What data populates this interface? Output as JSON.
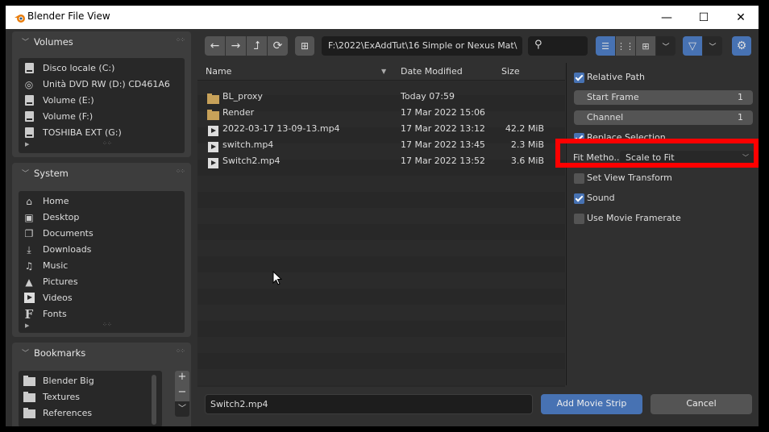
{
  "window": {
    "title": "Blender File View",
    "controls": [
      "—",
      "☐",
      "✕"
    ]
  },
  "sidebar": {
    "volumes": {
      "label": "Volumes",
      "items": [
        {
          "icon": "drive-icon",
          "label": "Disco locale (C:)"
        },
        {
          "icon": "dvd-icon",
          "label": "Unità DVD RW (D:) CD461A6"
        },
        {
          "icon": "drive-icon",
          "label": "Volume (E:)"
        },
        {
          "icon": "drive-icon",
          "label": "Volume (F:)"
        },
        {
          "icon": "drive-icon",
          "label": "TOSHIBA EXT (G:)"
        }
      ]
    },
    "system": {
      "label": "System",
      "items": [
        {
          "icon": "home-icon",
          "glyph": "⌂",
          "label": "Home"
        },
        {
          "icon": "desktop-icon",
          "glyph": "▣",
          "label": "Desktop"
        },
        {
          "icon": "documents-icon",
          "glyph": "❐",
          "label": "Documents"
        },
        {
          "icon": "download-icon",
          "glyph": "⤓",
          "label": "Downloads"
        },
        {
          "icon": "music-icon",
          "glyph": "♫",
          "label": "Music"
        },
        {
          "icon": "pictures-icon",
          "glyph": "▲",
          "label": "Pictures"
        },
        {
          "icon": "videos-icon",
          "glyph": "▶",
          "label": "Videos"
        },
        {
          "icon": "fonts-icon",
          "glyph": "F",
          "label": "Fonts"
        }
      ]
    },
    "bookmarks": {
      "label": "Bookmarks",
      "items": [
        {
          "label": "Blender Big"
        },
        {
          "label": "Textures"
        },
        {
          "label": "References"
        }
      ]
    }
  },
  "toolbar": {
    "back": "←",
    "forward": "→",
    "parent": "⮥",
    "refresh": "⟳",
    "path": "F:\\2022\\ExAddTut\\16 Simple or Nexus Mat\\",
    "search_placeholder": ""
  },
  "filelist": {
    "columns": {
      "name": "Name",
      "date": "Date Modified",
      "size": "Size"
    },
    "rows": [
      {
        "type": "folder",
        "name": "BL_proxy",
        "date": "Today 07:59",
        "size": ""
      },
      {
        "type": "folder",
        "name": "Render",
        "date": "17 Mar 2022 15:06",
        "size": ""
      },
      {
        "type": "movie",
        "name": "2022-03-17 13-09-13.mp4",
        "date": "17 Mar 2022 13:12",
        "size": "42.2 MiB"
      },
      {
        "type": "movie",
        "name": "switch.mp4",
        "date": "17 Mar 2022 13:45",
        "size": "2.3 MiB"
      },
      {
        "type": "movie",
        "name": "Switch2.mp4",
        "date": "17 Mar 2022 13:52",
        "size": "3.6 MiB"
      }
    ]
  },
  "props": {
    "relative_path": {
      "label": "Relative Path",
      "checked": true
    },
    "start_frame": {
      "label": "Start Frame",
      "value": "1"
    },
    "channel": {
      "label": "Channel",
      "value": "1"
    },
    "replace_selection": {
      "label": "Replace Selection",
      "checked": true
    },
    "fit_method": {
      "label": "Fit Metho...",
      "value": "Scale to Fit"
    },
    "set_view_transform": {
      "label": "Set View Transform",
      "checked": false
    },
    "sound": {
      "label": "Sound",
      "checked": true
    },
    "use_movie_framerate": {
      "label": "Use Movie Framerate",
      "checked": false
    }
  },
  "bottom": {
    "filename": "Switch2.mp4",
    "confirm": "Add Movie Strip",
    "cancel": "Cancel"
  },
  "colors": {
    "accent": "#4772b3",
    "highlight": "#ff0000",
    "folder": "#c7a159"
  }
}
